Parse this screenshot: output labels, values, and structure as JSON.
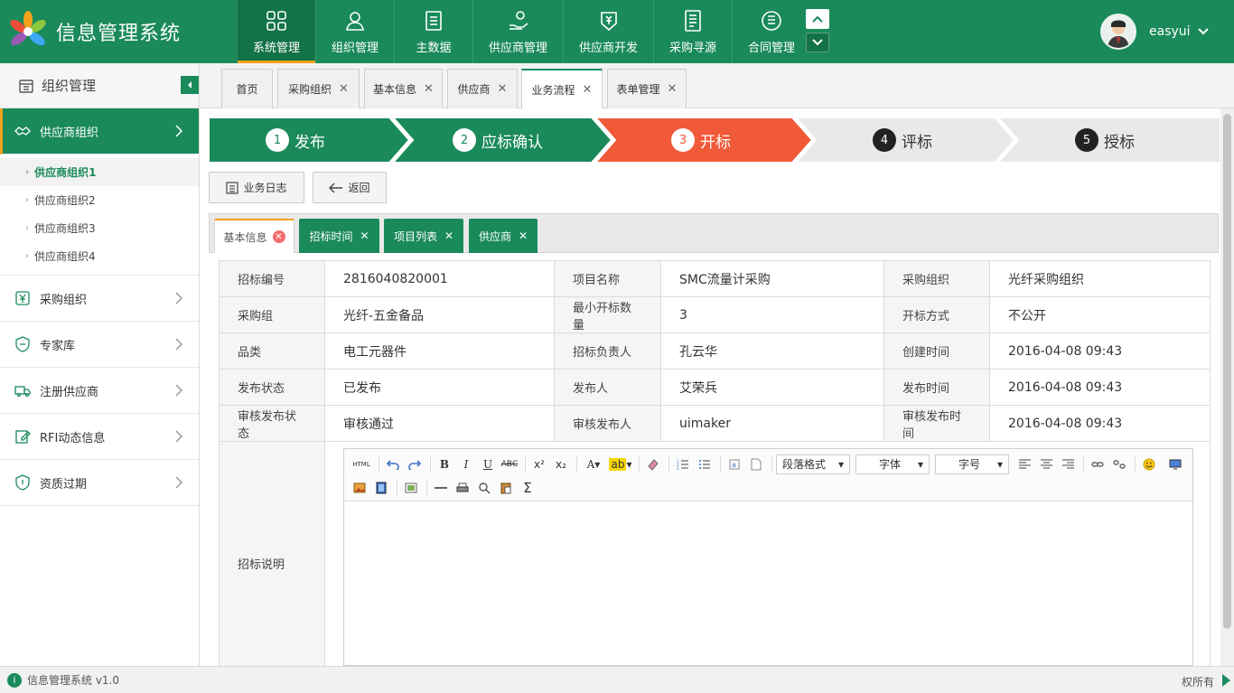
{
  "app": {
    "title": "信息管理系统",
    "version_text": "信息管理系统 v1.0",
    "footer_right": "权所有"
  },
  "colors": {
    "primary": "#1a8a5b",
    "primary_dark": "#137348",
    "accent": "#f4a21b",
    "active_step": "#f05a38",
    "inactive_step": "#e9e9e9"
  },
  "nav": {
    "items": [
      {
        "label": "系统管理",
        "icon": "grid-icon"
      },
      {
        "label": "组织管理",
        "icon": "user-icon"
      },
      {
        "label": "主数据",
        "icon": "document-icon"
      },
      {
        "label": "供应商管理",
        "icon": "hand-coin-icon"
      },
      {
        "label": "供应商开发",
        "icon": "money-tag-icon"
      },
      {
        "label": "采购寻源",
        "icon": "list-document-icon"
      },
      {
        "label": "合同管理",
        "icon": "contract-icon"
      }
    ],
    "up_icon": "chevron-up-icon",
    "down_icon": "chevron-down-icon"
  },
  "user": {
    "name": "easyui"
  },
  "sidebar": {
    "title": "组织管理",
    "groups": [
      {
        "label": "供应商组织",
        "icon": "handshake-icon"
      },
      {
        "label": "采购组织",
        "icon": "yen-icon"
      },
      {
        "label": "专家库",
        "icon": "badge-icon"
      },
      {
        "label": "注册供应商",
        "icon": "truck-icon"
      },
      {
        "label": "RFI动态信息",
        "icon": "edit-icon"
      },
      {
        "label": "资质过期",
        "icon": "shield-icon"
      }
    ],
    "sub_items": [
      "供应商组织1",
      "供应商组织2",
      "供应商组织3",
      "供应商组织4"
    ]
  },
  "page_tabs": [
    {
      "label": "首页"
    },
    {
      "label": "采购组织"
    },
    {
      "label": "基本信息"
    },
    {
      "label": "供应商"
    },
    {
      "label": "业务流程"
    },
    {
      "label": "表单管理"
    }
  ],
  "steps": [
    {
      "num": "1",
      "label": "发布"
    },
    {
      "num": "2",
      "label": "应标确认"
    },
    {
      "num": "3",
      "label": "开标"
    },
    {
      "num": "4",
      "label": "评标"
    },
    {
      "num": "5",
      "label": "授标"
    }
  ],
  "buttons": {
    "log": "业务日志",
    "back": "返回"
  },
  "inner_tabs": [
    {
      "label": "基本信息"
    },
    {
      "label": "招标时间"
    },
    {
      "label": "项目列表"
    },
    {
      "label": "供应商"
    }
  ],
  "form": {
    "rows": [
      [
        {
          "label": "招标编号",
          "value": "2816040820001"
        },
        {
          "label": "项目名称",
          "value": "SMC流量计采购"
        },
        {
          "label": "采购组织",
          "value": "光纤采购组织"
        }
      ],
      [
        {
          "label": "采购组",
          "value": "光纤-五金备品"
        },
        {
          "label": "最小开标数量",
          "value": "3"
        },
        {
          "label": "开标方式",
          "value": "不公开"
        }
      ],
      [
        {
          "label": "品类",
          "value": "电工元器件"
        },
        {
          "label": "招标负责人",
          "value": "孔云华"
        },
        {
          "label": "创建时间",
          "value": "2016-04-08 09:43"
        }
      ],
      [
        {
          "label": "发布状态",
          "value": "已发布"
        },
        {
          "label": "发布人",
          "value": "艾荣兵"
        },
        {
          "label": "发布时间",
          "value": "2016-04-08 09:43"
        }
      ],
      [
        {
          "label": "审核发布状态",
          "value": "审核通过"
        },
        {
          "label": "审核发布人",
          "value": "uimaker"
        },
        {
          "label": "审核发布时间",
          "value": "2016-04-08 09:43"
        }
      ]
    ],
    "description_label": "招标说明"
  },
  "editor": {
    "html_label": "HTML",
    "paragraph_format": "段落格式",
    "font_family": "字体",
    "font_size": "字号"
  }
}
